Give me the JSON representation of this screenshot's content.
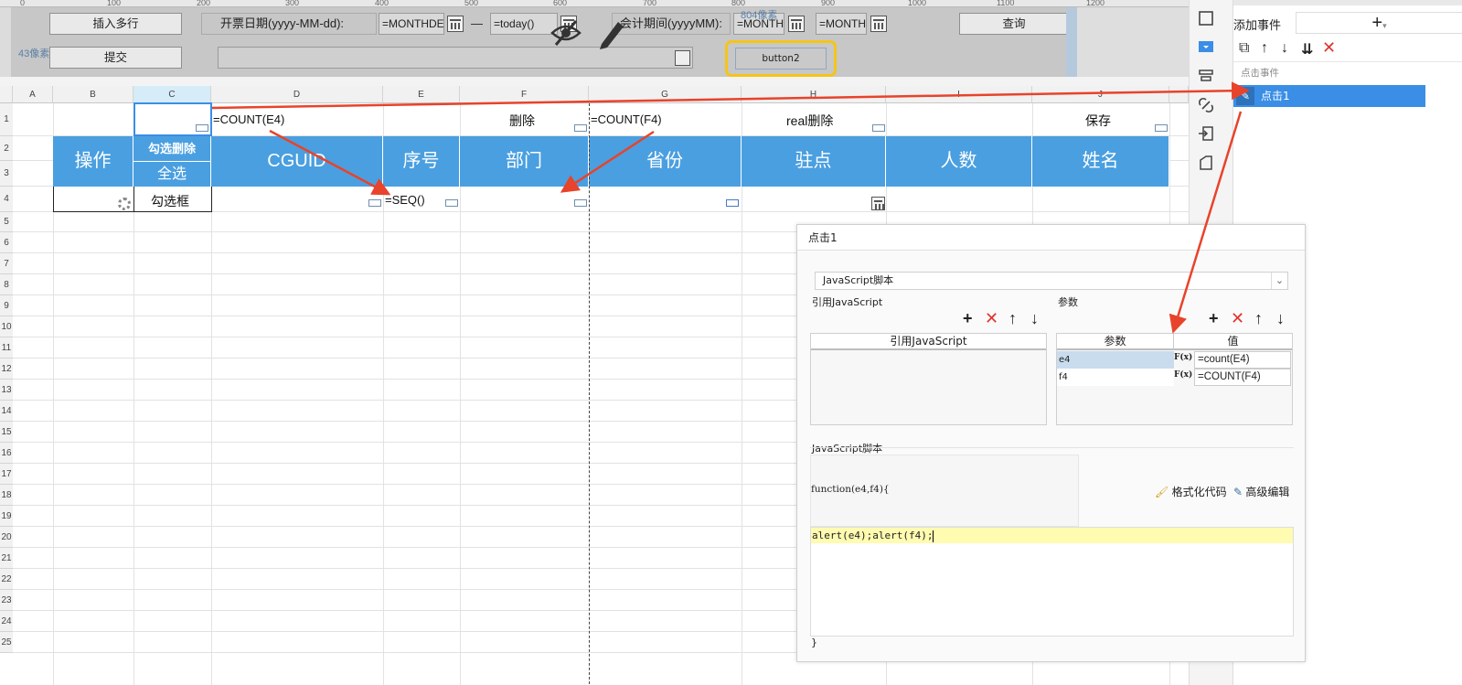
{
  "ruler": {
    "ticks": [
      "0",
      "100",
      "200",
      "300",
      "400",
      "500",
      "600",
      "700",
      "800",
      "900",
      "1000",
      "1100",
      "1200"
    ]
  },
  "params": {
    "insert_rows": "插入多行",
    "submit": "提交",
    "invoice_date_label": "开票日期(yyyy-MM-dd):",
    "invoice_from": "=MONTHDE",
    "dash": "—",
    "invoice_to": "=today()",
    "period_label": "会计期间(yyyyMM):",
    "period_from": "=MONTH",
    "period_to": "=MONTH",
    "query": "查询",
    "px_note_left": "43像素",
    "px_note_right": "804像素",
    "button2": "button2"
  },
  "grid": {
    "columns": [
      "A",
      "B",
      "C",
      "D",
      "E",
      "F",
      "G",
      "H",
      "I",
      "J"
    ],
    "rows": [
      "1",
      "2",
      "3",
      "4",
      "5",
      "6",
      "7",
      "8",
      "9",
      "10",
      "11",
      "12",
      "13",
      "14",
      "15",
      "16",
      "17",
      "18",
      "19",
      "20",
      "21",
      "22",
      "23",
      "24",
      "25"
    ],
    "row1": {
      "c1": "=COUNT(E4)",
      "delete": "删除",
      "c2": "=COUNT(F4)",
      "real_delete": "real删除",
      "save": "保存"
    },
    "headers": {
      "op": "操作",
      "check_delete": "勾选删除",
      "select_all": "全选",
      "cguid": "CGUID",
      "seq": "序号",
      "dept": "部门",
      "province": "省份",
      "site": "驻点",
      "count": "人数",
      "name": "姓名"
    },
    "row4": {
      "checkbox": "勾选框",
      "seq": "=SEQ()"
    }
  },
  "sidebar": {
    "add_event": "添加事件",
    "plus": "+",
    "section": "点击事件",
    "event_item": "点击1"
  },
  "dialog": {
    "title": "点击1",
    "type_select": "JavaScript脚本",
    "ref_js_label": "引用JavaScript",
    "params_label": "参数",
    "ref_js_col": "引用JavaScript",
    "param_col": "参数",
    "value_col": "值",
    "params": [
      {
        "name": "e4",
        "fx": "F(x)",
        "value": "=count(E4)"
      },
      {
        "name": "f4",
        "fx": "F(x)",
        "value": "=COUNT(F4)"
      }
    ],
    "script_label": "JavaScript脚本",
    "func_header": "function(e4,f4){",
    "format_code": "格式化代码",
    "advanced_edit": "高级编辑",
    "code_line": "alert(e4);alert(f4);",
    "closing": "}"
  },
  "colors": {
    "header_blue": "#4a9fe0",
    "arrow_red": "#e8432b",
    "highlight_yellow": "#f5c518",
    "select_blue": "#3a8ee6"
  }
}
